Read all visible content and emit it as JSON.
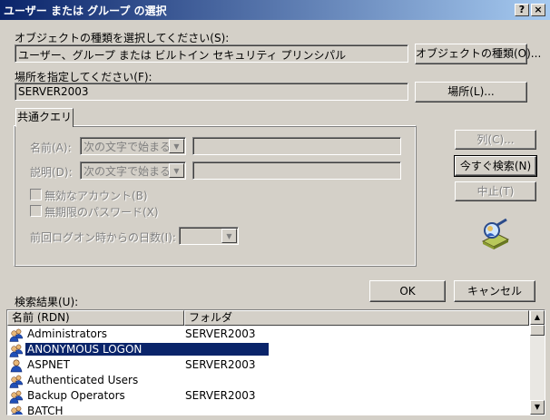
{
  "window": {
    "title": "ユーザー または グループ の選択",
    "help_button": "?",
    "close_button": "×"
  },
  "object_type": {
    "label": "オブジェクトの種類を選択してください(S):",
    "value": "ユーザー、グループ または ビルトイン セキュリティ プリンシパル",
    "button": "オブジェクトの種類(O)..."
  },
  "location": {
    "label": "場所を指定してください(F):",
    "value": "SERVER2003",
    "button": "場所(L)..."
  },
  "query": {
    "tab_label": "共通クエリ",
    "name_label": "名前(A):",
    "name_combo": "次の文字で始まる",
    "description_label": "説明(D):",
    "description_combo": "次の文字で始まる",
    "disabled_accounts": "無効なアカウント(B)",
    "non_expiring_password": "無期限のパスワード(X)",
    "days_since_logon_label": "前回ログオン時からの日数(I):"
  },
  "side_buttons": {
    "columns": "列(C)...",
    "find_now": "今すぐ検索(N)",
    "stop": "中止(T)"
  },
  "actions": {
    "ok": "OK",
    "cancel": "キャンセル"
  },
  "results": {
    "label": "検索結果(U):",
    "columns": [
      "名前 (RDN)",
      "フォルダ"
    ],
    "rows": [
      {
        "name": "Administrators",
        "folder": "SERVER2003",
        "icon": "group-icon",
        "selected": false
      },
      {
        "name": "ANONYMOUS LOGON",
        "folder": "",
        "icon": "group-icon",
        "selected": true
      },
      {
        "name": "ASPNET",
        "folder": "SERVER2003",
        "icon": "user-icon",
        "selected": false
      },
      {
        "name": "Authenticated Users",
        "folder": "",
        "icon": "group-icon",
        "selected": false
      },
      {
        "name": "Backup Operators",
        "folder": "SERVER2003",
        "icon": "group-icon",
        "selected": false
      },
      {
        "name": "BATCH",
        "folder": "",
        "icon": "group-icon",
        "selected": false
      }
    ]
  },
  "colors": {
    "dialog_bg": "#d4d0c8",
    "title_start": "#0a246a",
    "title_end": "#a6caf0",
    "selection": "#0a246a"
  }
}
